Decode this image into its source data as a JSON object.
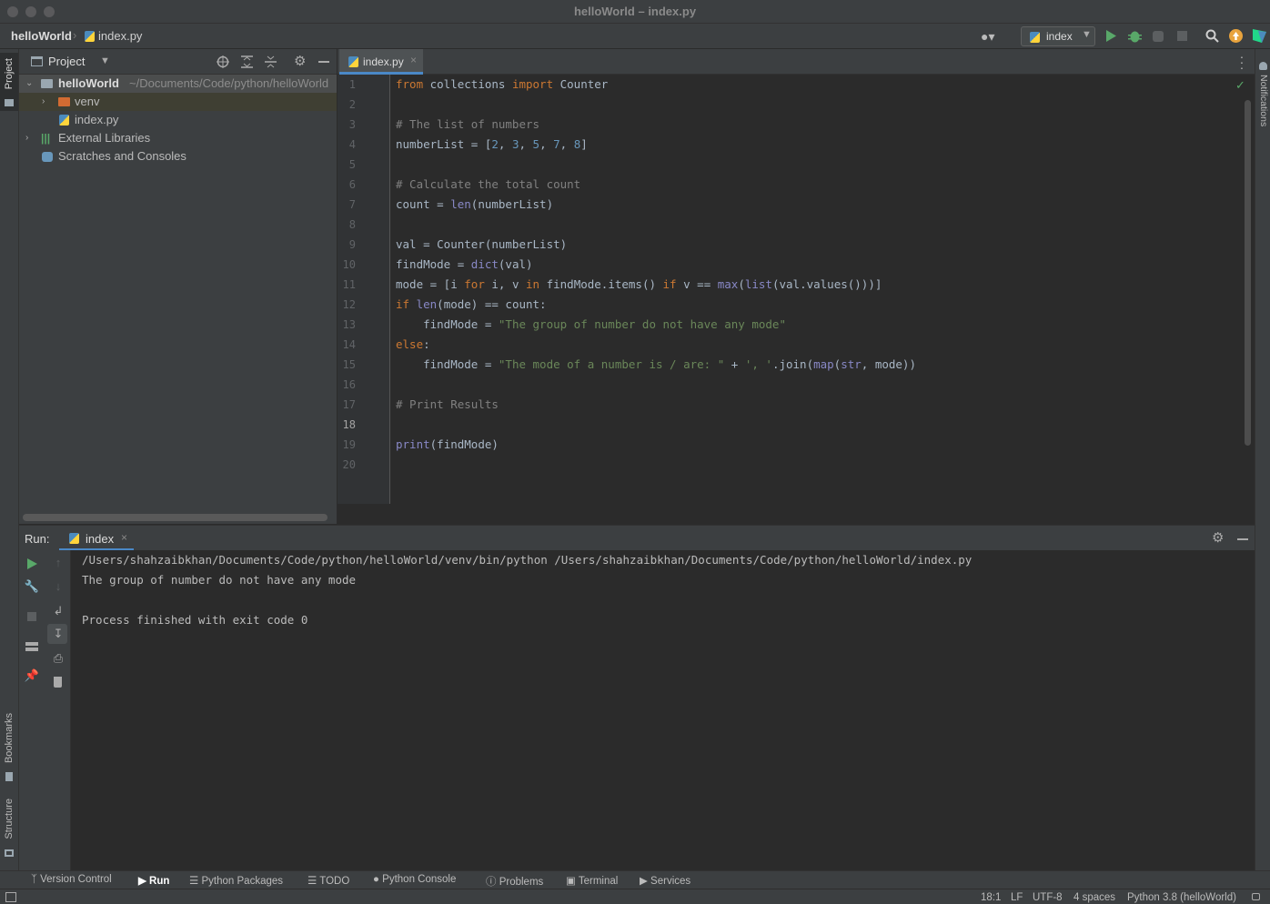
{
  "window": {
    "title": "helloWorld – index.py"
  },
  "navbar": {
    "project": "helloWorld",
    "file": "index.py",
    "run_config": "index"
  },
  "left_stripe": {
    "project": "Project",
    "bookmarks": "Bookmarks",
    "structure": "Structure"
  },
  "right_stripe": {
    "notifications": "Notifications"
  },
  "project_panel": {
    "title": "Project",
    "tree": [
      {
        "label": "helloWorld",
        "path": "~/Documents/Code/python/helloWorld"
      },
      {
        "label": "venv"
      },
      {
        "label": "index.py"
      },
      {
        "label": "External Libraries"
      },
      {
        "label": "Scratches and Consoles"
      }
    ]
  },
  "editor": {
    "tab": "index.py",
    "line_numbers": [
      "1",
      "2",
      "3",
      "4",
      "5",
      "6",
      "7",
      "8",
      "9",
      "10",
      "11",
      "12",
      "13",
      "14",
      "15",
      "16",
      "17",
      "18",
      "19",
      "20"
    ],
    "current_line": "18"
  },
  "run_panel": {
    "label": "Run:",
    "tab": "index",
    "output": [
      "/Users/shahzaibkhan/Documents/Code/python/helloWorld/venv/bin/python /Users/shahzaibkhan/Documents/Code/python/helloWorld/index.py",
      "The group of number do not have any mode",
      "",
      "Process finished with exit code 0"
    ]
  },
  "bottom_tools": {
    "version_control": "Version Control",
    "run": "Run",
    "python_packages": "Python Packages",
    "todo": "TODO",
    "python_console": "Python Console",
    "problems": "Problems",
    "terminal": "Terminal",
    "services": "Services"
  },
  "status": {
    "position": "18:1",
    "line_sep": "LF",
    "encoding": "UTF-8",
    "indent": "4 spaces",
    "interpreter": "Python 3.8 (helloWorld)"
  },
  "colors": {
    "keyword": "#cc7832",
    "comment": "#808080",
    "number": "#6897bb",
    "string": "#6a8759",
    "builtin": "#8888c6",
    "run_green": "#59a869"
  }
}
